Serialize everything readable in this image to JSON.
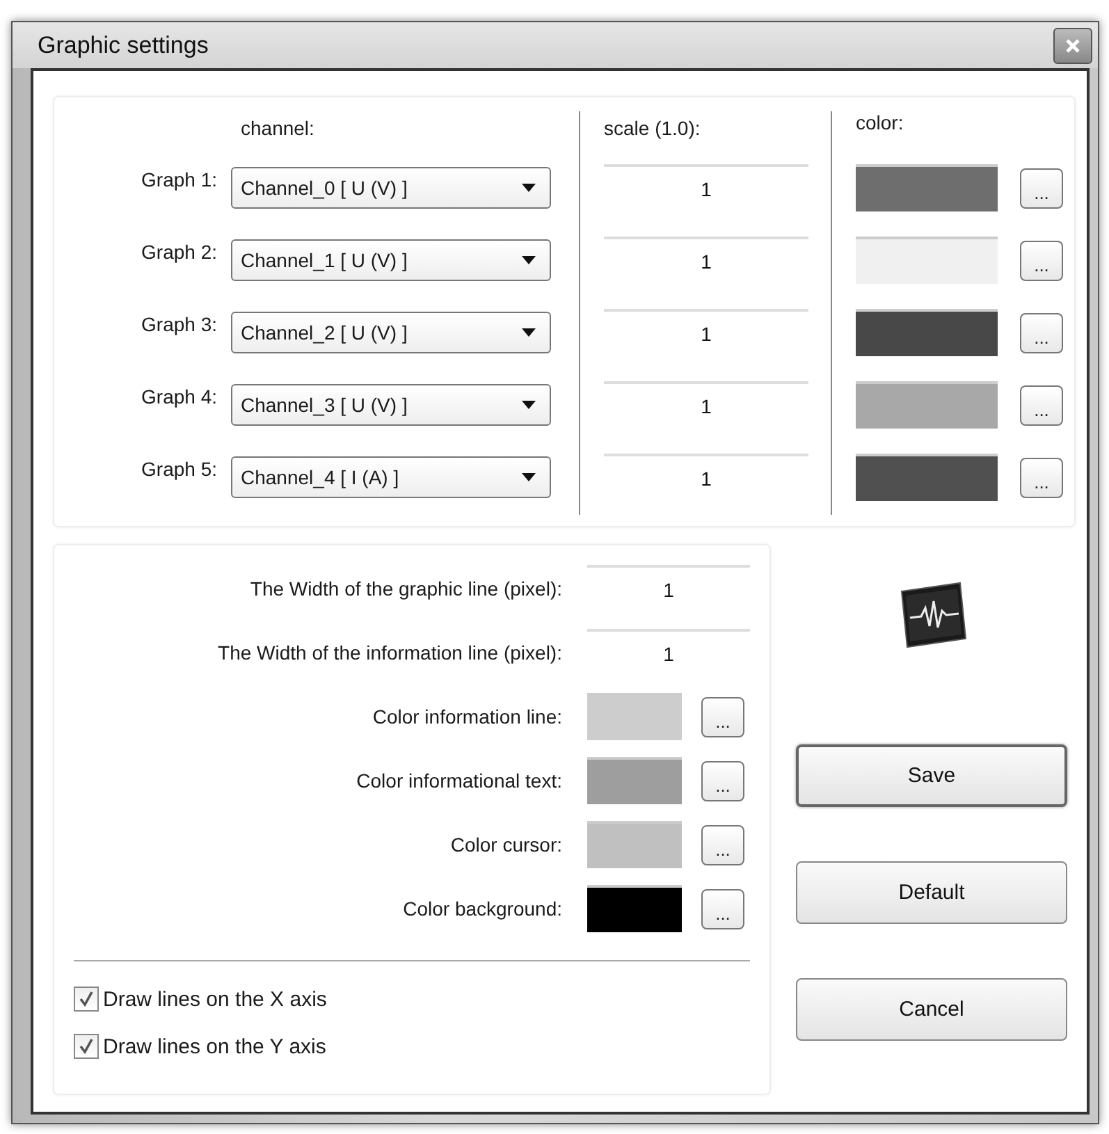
{
  "window": {
    "title": "Graphic settings"
  },
  "graphs": {
    "headers": [
      "channel:",
      "scale (1.0):",
      "color:"
    ],
    "rows": [
      {
        "label": "Graph 1:",
        "channel": "Channel_0 [ U (V) ]",
        "scale": "1",
        "color": "#6e6e6e",
        "picker": "..."
      },
      {
        "label": "Graph 2:",
        "channel": "Channel_1 [ U (V) ]",
        "scale": "1",
        "color": "#f0f0f0",
        "picker": "..."
      },
      {
        "label": "Graph 3:",
        "channel": "Channel_2 [ U (V) ]",
        "scale": "1",
        "color": "#484848",
        "picker": "..."
      },
      {
        "label": "Graph 4:",
        "channel": "Channel_3 [ U (V) ]",
        "scale": "1",
        "color": "#a8a8a8",
        "picker": "..."
      },
      {
        "label": "Graph 5:",
        "channel": "Channel_4 [ I (A) ]",
        "scale": "1",
        "color": "#505050",
        "picker": "..."
      }
    ]
  },
  "line_settings": [
    {
      "kind": "field",
      "label": "The Width of the graphic line (pixel):",
      "value": "1"
    },
    {
      "kind": "field",
      "label": "The Width of the information line (pixel):",
      "value": "1"
    },
    {
      "kind": "color",
      "label": "Color information line:",
      "color": "#cdcdcd",
      "picker": "..."
    },
    {
      "kind": "color",
      "label": "Color informational text:",
      "color": "#9e9e9e",
      "picker": "..."
    },
    {
      "kind": "color",
      "label": "Color cursor:",
      "color": "#c0c0c0",
      "picker": "..."
    },
    {
      "kind": "color",
      "label": "Color background:",
      "color": "#000000",
      "picker": "..."
    }
  ],
  "checks": [
    {
      "label": "Draw lines on the X axis",
      "checked": true
    },
    {
      "label": "Draw lines on the Y axis",
      "checked": true
    }
  ],
  "buttons": [
    {
      "label": "Save",
      "focused": true
    },
    {
      "label": "Default",
      "focused": false
    },
    {
      "label": "Cancel",
      "focused": false
    }
  ]
}
